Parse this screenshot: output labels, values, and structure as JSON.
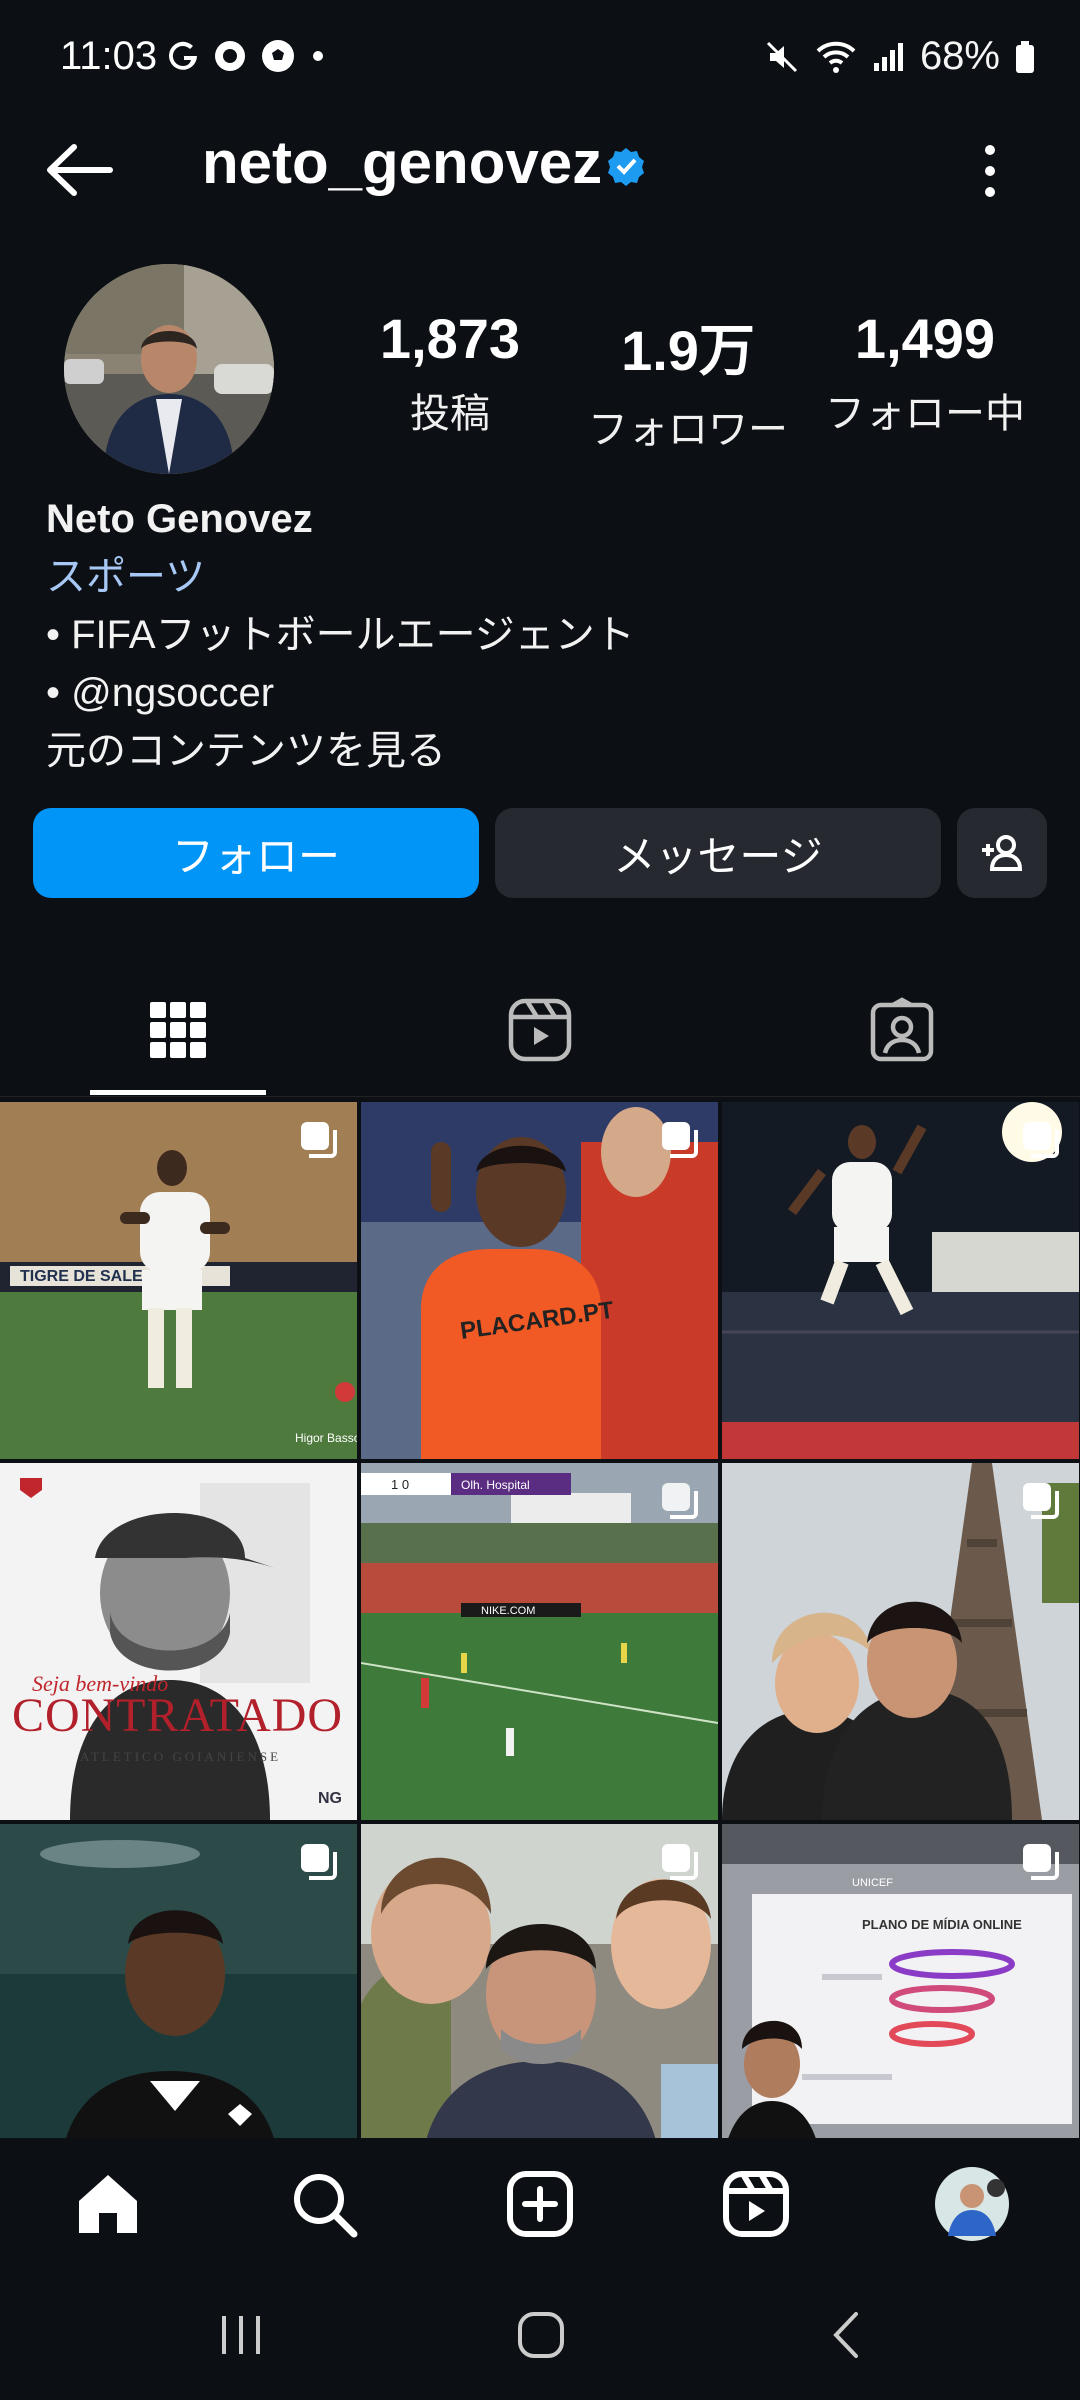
{
  "status_bar": {
    "time": "11:03",
    "battery": "68%",
    "left_icons": [
      "google-icon",
      "notification-icon",
      "soccer-ball-icon",
      "dot-icon"
    ],
    "right_icons": [
      "mute-icon",
      "wifi-icon",
      "signal-icon",
      "battery-icon"
    ]
  },
  "header": {
    "username": "neto_genovez",
    "verified_color": "#1d9bf0"
  },
  "profile": {
    "stats": [
      {
        "value": "1,873",
        "label": "投稿"
      },
      {
        "value": "1.9万",
        "label": "フォロワー"
      },
      {
        "value": "1,499",
        "label": "フォロー中"
      }
    ],
    "name": "Neto Genovez",
    "category": "スポーツ",
    "bio_lines": [
      "• FIFAフットボールエージェント",
      "• @ngsoccer"
    ],
    "see_original": "元のコンテンツを見る"
  },
  "actions": {
    "follow": "フォロー",
    "message": "メッセージ"
  },
  "colors": {
    "accent": "#0095f6",
    "background": "#0c0f14",
    "button_dark": "#262a30"
  },
  "grid": {
    "tile4_banner": "CONTRATADO",
    "tile4_sub": "ATLETICO GOIANIENSE",
    "tile4_script": "Seja bem-vindo",
    "tile4_logo": "NG",
    "tile1_watermark": "Higor Basso",
    "tile1_ad": "TIGRE DE SALES",
    "tile2_shirt": "PLACARD.PT",
    "tile5_score": "1 0",
    "tile5_team": "Olh. Hospital",
    "tile5_ad": "NIKE.COM",
    "tile9_title": "PLANO DE MÍDIA ONLINE",
    "tile9_brand": "UNICEF"
  },
  "bottom_nav": [
    "home-icon",
    "search-icon",
    "create-icon",
    "reels-icon",
    "profile-avatar"
  ],
  "system_nav": [
    "recents-button",
    "home-button",
    "back-button"
  ]
}
